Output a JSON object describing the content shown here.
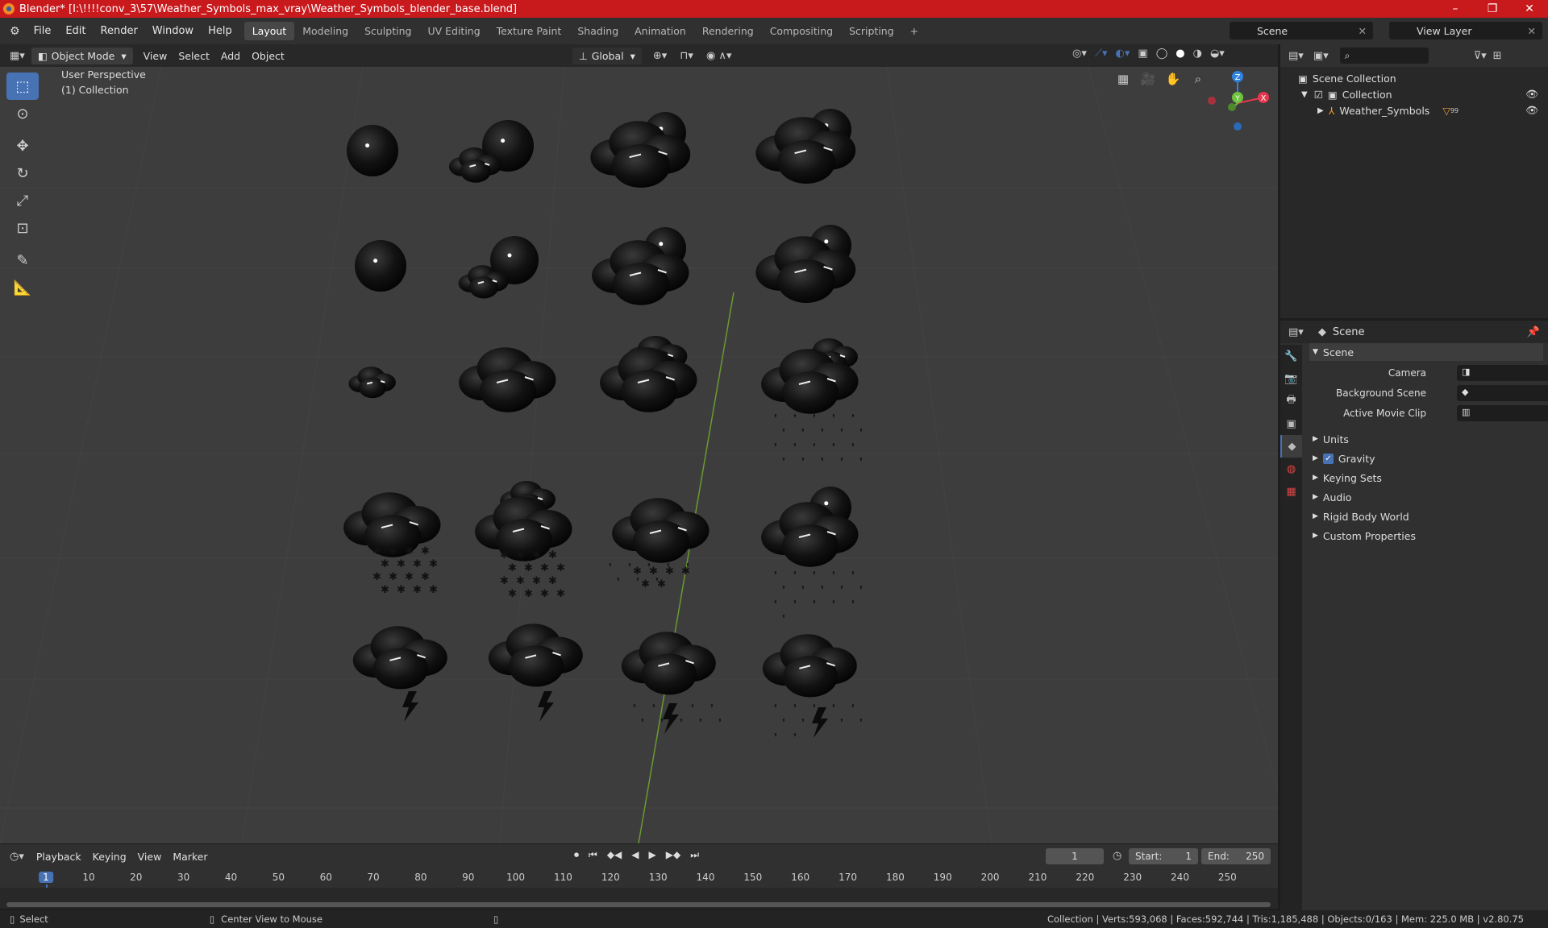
{
  "window": {
    "title": "Blender* [I:\\!!!!conv_3\\57\\Weather_Symbols_max_vray\\Weather_Symbols_blender_base.blend]",
    "minimize": "–",
    "maximize": "❐",
    "close": "✕"
  },
  "menu": [
    "File",
    "Edit",
    "Render",
    "Window",
    "Help"
  ],
  "workspaces": [
    "Layout",
    "Modeling",
    "Sculpting",
    "UV Editing",
    "Texture Paint",
    "Shading",
    "Animation",
    "Rendering",
    "Compositing",
    "Scripting"
  ],
  "active_workspace": "Layout",
  "scene_name": "Scene",
  "view_layer": "View Layer",
  "viewport": {
    "mode": "Object Mode",
    "menus": [
      "View",
      "Select",
      "Add",
      "Object"
    ],
    "orientation": "Global",
    "perspective": "User Perspective",
    "collection": "(1) Collection",
    "gizmo": {
      "x": "X",
      "y": "Y",
      "z": "Z"
    }
  },
  "outliner": {
    "root": "Scene Collection",
    "collection": "Collection",
    "object": "Weather_Symbols",
    "object_suffix": "99"
  },
  "properties": {
    "context": "Scene",
    "panel": "Scene",
    "fields": [
      "Camera",
      "Background Scene",
      "Active Movie Clip"
    ],
    "subpanels": [
      "Units",
      "Gravity",
      "Keying Sets",
      "Audio",
      "Rigid Body World",
      "Custom Properties"
    ],
    "gravity_checked": true
  },
  "timeline": {
    "menus": [
      "Playback",
      "Keying",
      "View",
      "Marker"
    ],
    "current_frame": "1",
    "start_label": "Start:",
    "start": "1",
    "end_label": "End:",
    "end": "250",
    "ticks": [
      "1",
      "10",
      "20",
      "30",
      "40",
      "50",
      "60",
      "70",
      "80",
      "90",
      "100",
      "110",
      "120",
      "130",
      "140",
      "150",
      "160",
      "170",
      "180",
      "190",
      "200",
      "210",
      "220",
      "230",
      "240",
      "250"
    ]
  },
  "status": {
    "left": "Select",
    "middle": "Center View to Mouse",
    "right": "Collection | Verts:593,068 | Faces:592,744 | Tris:1,185,488 | Objects:0/163 | Mem: 225.0 MB | v2.80.75"
  },
  "colors": {
    "accent": "#4772b3",
    "titlebar": "#c8191d",
    "axis_x": "#e8364f",
    "axis_y": "#6ec23c",
    "axis_z": "#2f83e3"
  }
}
